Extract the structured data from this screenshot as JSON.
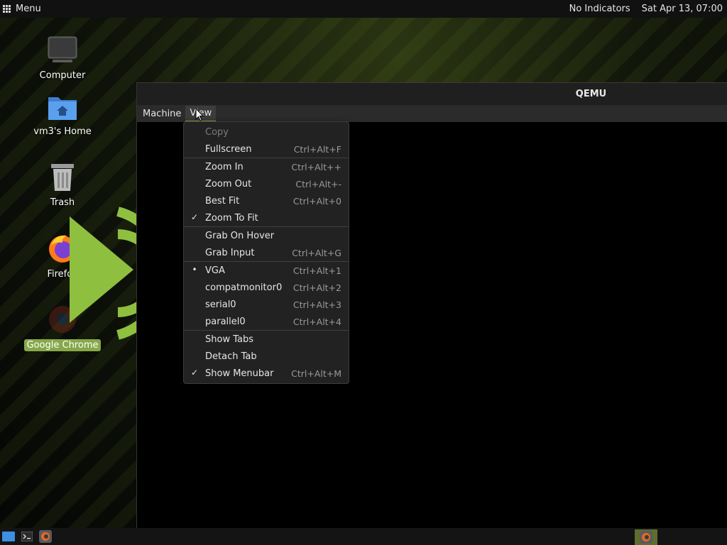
{
  "top_panel": {
    "menu_label": "Menu",
    "indicators": "No Indicators",
    "clock": "Sat Apr 13, 07:00"
  },
  "desktop": {
    "icons": [
      {
        "label": "Computer",
        "icon": "computer-icon"
      },
      {
        "label": "vm3's Home",
        "icon": "home-folder-icon"
      },
      {
        "label": "Trash",
        "icon": "trash-icon"
      },
      {
        "label": "Firefox",
        "icon": "firefox-icon"
      },
      {
        "label": "Google Chrome",
        "icon": "chrome-icon",
        "selected": true
      }
    ]
  },
  "window": {
    "title": "QEMU",
    "menubar": [
      "Machine",
      "View"
    ],
    "active_menu": "View"
  },
  "view_menu": {
    "items": [
      {
        "label": "Copy",
        "accel": "",
        "disabled": true,
        "mark": ""
      },
      {
        "label": "Fullscreen",
        "accel": "Ctrl+Alt+F",
        "mark": ""
      },
      {
        "label": "Zoom In",
        "accel": "Ctrl+Alt++",
        "mark": ""
      },
      {
        "label": "Zoom Out",
        "accel": "Ctrl+Alt+-",
        "mark": ""
      },
      {
        "label": "Best Fit",
        "accel": "Ctrl+Alt+0",
        "mark": ""
      },
      {
        "label": "Zoom To Fit",
        "accel": "",
        "mark": "✓"
      },
      {
        "label": "Grab On Hover",
        "accel": "",
        "mark": ""
      },
      {
        "label": "Grab Input",
        "accel": "Ctrl+Alt+G",
        "mark": ""
      },
      {
        "label": "VGA",
        "accel": "Ctrl+Alt+1",
        "mark": "•"
      },
      {
        "label": "compatmonitor0",
        "accel": "Ctrl+Alt+2",
        "mark": ""
      },
      {
        "label": "serial0",
        "accel": "Ctrl+Alt+3",
        "mark": ""
      },
      {
        "label": "parallel0",
        "accel": "Ctrl+Alt+4",
        "mark": ""
      },
      {
        "label": "Show Tabs",
        "accel": "",
        "mark": ""
      },
      {
        "label": "Detach Tab",
        "accel": "",
        "mark": ""
      },
      {
        "label": "Show Menubar",
        "accel": "Ctrl+Alt+M",
        "mark": "✓"
      }
    ]
  },
  "colors": {
    "accent": "#87a84a",
    "panel": "#111111",
    "menu_bg": "#222222"
  }
}
